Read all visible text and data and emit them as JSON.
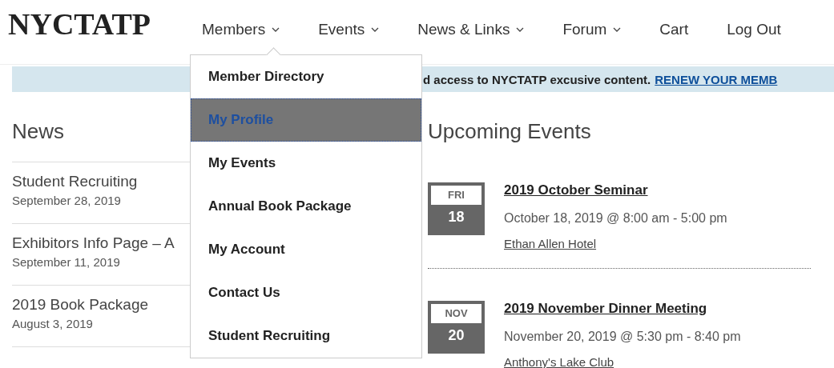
{
  "logo": "NYCTATP",
  "nav": [
    {
      "label": "Members",
      "has_submenu": true,
      "submenu": [
        {
          "label": "Member Directory",
          "selected": false
        },
        {
          "label": "My Profile",
          "selected": true
        },
        {
          "label": "My Events",
          "selected": false
        },
        {
          "label": "Annual Book Package",
          "selected": false
        },
        {
          "label": "My Account",
          "selected": false
        },
        {
          "label": "Contact Us",
          "selected": false
        },
        {
          "label": "Student Recruiting",
          "selected": false
        }
      ]
    },
    {
      "label": "Events",
      "has_submenu": true
    },
    {
      "label": "News & Links",
      "has_submenu": true
    },
    {
      "label": "Forum",
      "has_submenu": true
    },
    {
      "label": "Cart",
      "has_submenu": false
    },
    {
      "label": "Log Out",
      "has_submenu": false
    }
  ],
  "banner": {
    "text": "d access to NYCTATP excusive content.",
    "link": "RENEW YOUR MEMB"
  },
  "news": {
    "heading": "News",
    "items": [
      {
        "title": "Student Recruiting",
        "date": "September 28, 2019"
      },
      {
        "title": "Exhibitors Info Page – A",
        "date": "September 11, 2019"
      },
      {
        "title": "2019 Book Package",
        "date": "August 3, 2019"
      }
    ]
  },
  "events": {
    "heading": "Upcoming Events",
    "items": [
      {
        "weekday": "FRI",
        "day": "18",
        "title": "2019 October Seminar",
        "time": "October 18, 2019 @ 8:00 am - 5:00 pm",
        "venue": "Ethan Allen Hotel"
      },
      {
        "weekday": "NOV",
        "day": "20",
        "title": "2019 November Dinner Meeting",
        "time": "November 20, 2019 @ 5:30 pm - 8:40 pm",
        "venue": "Anthony's Lake Club"
      }
    ]
  }
}
